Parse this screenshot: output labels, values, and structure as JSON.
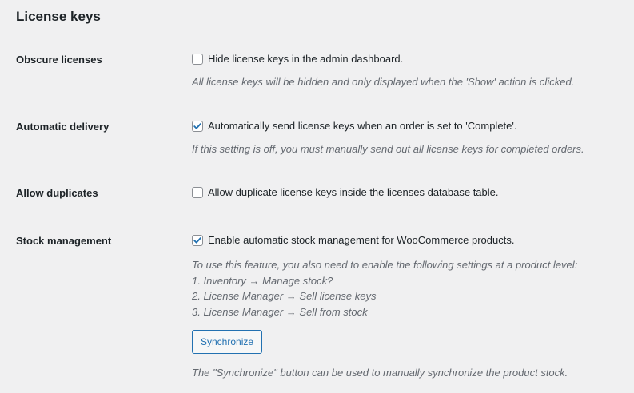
{
  "section": {
    "title": "License keys"
  },
  "settings": [
    {
      "label": "Obscure licenses",
      "checkbox_label": "Hide license keys in the admin dashboard.",
      "checked": false,
      "description": "All license keys will be hidden and only displayed when the 'Show' action is clicked."
    },
    {
      "label": "Automatic delivery",
      "checkbox_label": "Automatically send license keys when an order is set to 'Complete'.",
      "checked": true,
      "description": "If this setting is off, you must manually send out all license keys for completed orders."
    },
    {
      "label": "Allow duplicates",
      "checkbox_label": "Allow duplicate license keys inside the licenses database table.",
      "checked": false
    },
    {
      "label": "Stock management",
      "checkbox_label": "Enable automatic stock management for WooCommerce products.",
      "checked": true,
      "description_lines": [
        "To use this feature, you also need to enable the following settings at a product level:",
        "1. Inventory → Manage stock?",
        "2. License Manager → Sell license keys",
        "3. License Manager → Sell from stock"
      ],
      "button_label": "Synchronize",
      "button_description": "The \"Synchronize\" button can be used to manually synchronize the product stock."
    }
  ],
  "colors": {
    "background": "#f0f0f1",
    "accent": "#2271b1",
    "text": "#1d2327",
    "muted": "#646970"
  }
}
